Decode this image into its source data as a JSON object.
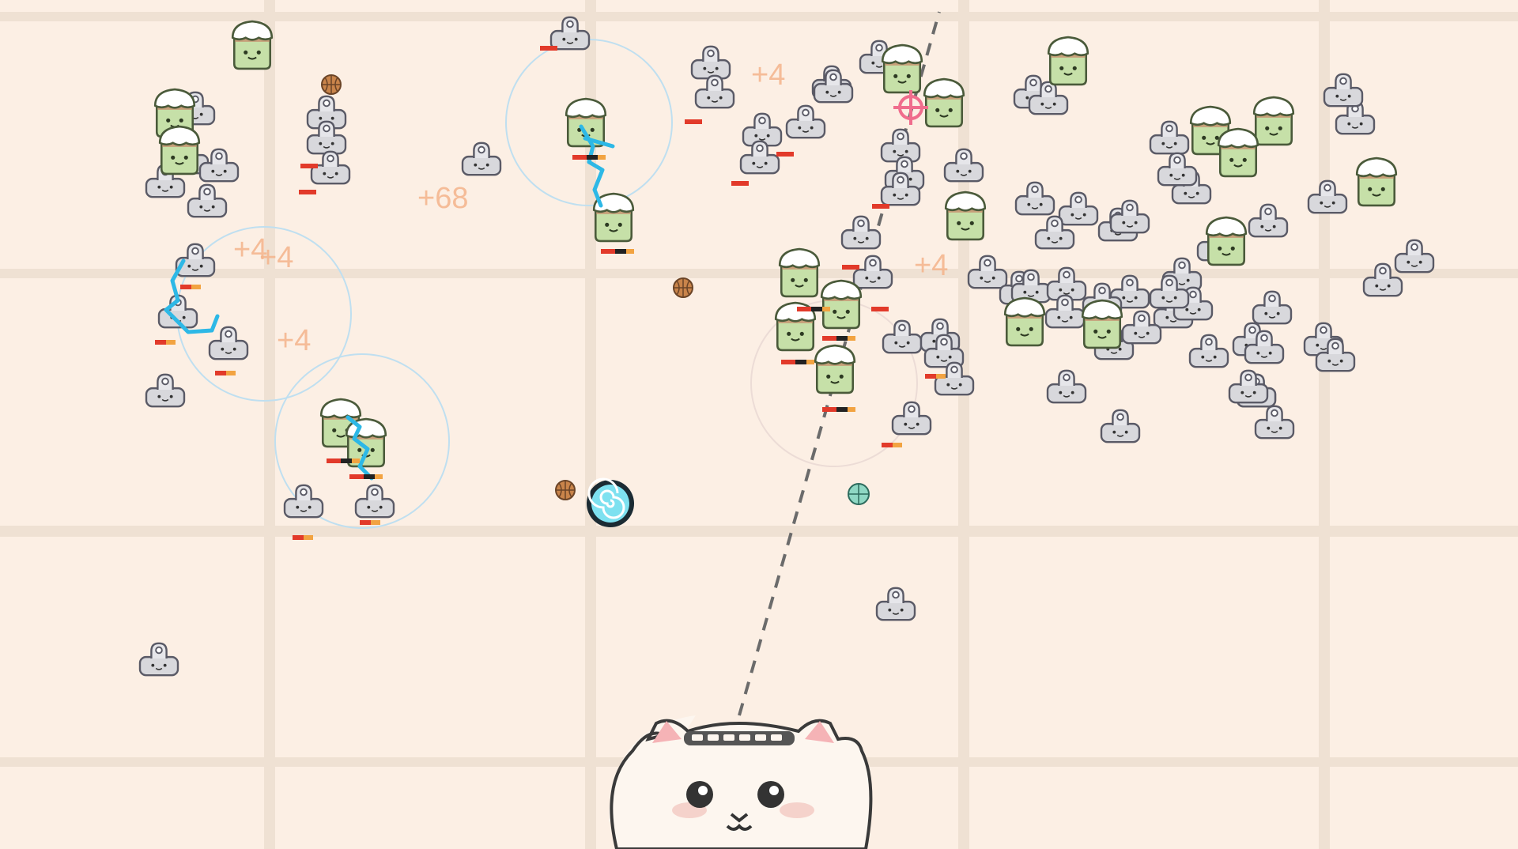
{
  "game": {
    "floating_scores": [
      "+68",
      "+4",
      "+4",
      "+4",
      "+4",
      "+4"
    ],
    "player": {
      "name": "cat-launcher"
    },
    "palette": {
      "background": "#fcefe4",
      "grid_line": "#efe1d3",
      "enemy_clip": "#d8d8dc",
      "enemy_cake": "#c6e0a8",
      "cake_frosting": "#ffffff",
      "lightning": "#2db8e6",
      "score_text": "#f4b48b",
      "health_red": "#e23a2a",
      "health_orange": "#f2a341",
      "crosshair": "#f06d8d"
    },
    "icons": {
      "clip_enemy": "binder-clip-enemy-icon",
      "cake_enemy": "matcha-cake-enemy-icon",
      "ball": "basketball-icon",
      "vortex": "spiral-vortex-icon",
      "target": "crosshair-icon"
    }
  }
}
